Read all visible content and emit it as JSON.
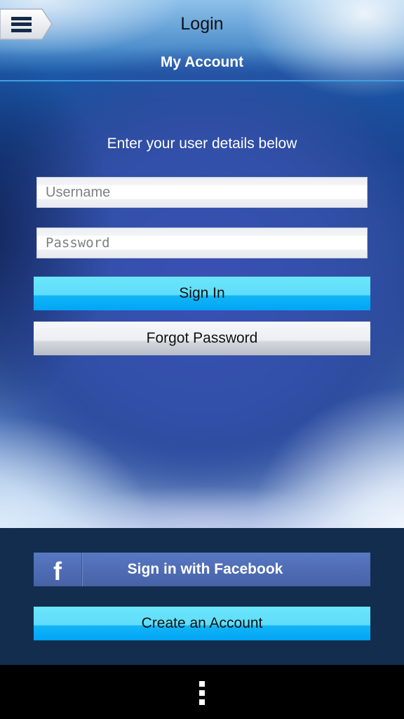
{
  "header": {
    "title": "Login",
    "subtitle": "My Account",
    "menu_icon": "hamburger-menu-icon"
  },
  "form": {
    "instructions": "Enter your user details below",
    "username": {
      "value": "",
      "placeholder": "Username"
    },
    "password": {
      "value": "",
      "placeholder": "Password"
    },
    "sign_in_label": "Sign In",
    "forgot_password_label": "Forgot Password"
  },
  "footer": {
    "facebook_icon": "f",
    "facebook_label": "Sign in with Facebook",
    "create_account_label": "Create an Account"
  },
  "navbar": {
    "overflow_icon": "vertical-dots-icon"
  },
  "colors": {
    "accent_cyan": "#02a4f5",
    "facebook_blue": "#4f6db5",
    "footer_bg": "#132d4e",
    "header_line": "#3f9fe0"
  }
}
